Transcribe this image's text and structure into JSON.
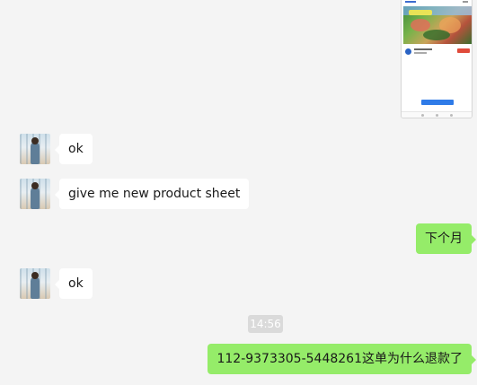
{
  "thumbnail": {
    "icon": "phone-screenshot-image"
  },
  "messages": [
    {
      "side": "left",
      "text": "ok"
    },
    {
      "side": "left",
      "text": "give me new product sheet"
    },
    {
      "side": "right",
      "text": "下个月"
    },
    {
      "side": "left",
      "text": "ok"
    },
    {
      "side": "right",
      "text": "112-9373305-5448261这单为什么退款了"
    }
  ],
  "timestamp": "14:56",
  "colors": {
    "background": "#f4f4f4",
    "incoming_bubble": "#ffffff",
    "outgoing_bubble": "#95ec69",
    "timestamp_bg": "#dadada"
  }
}
